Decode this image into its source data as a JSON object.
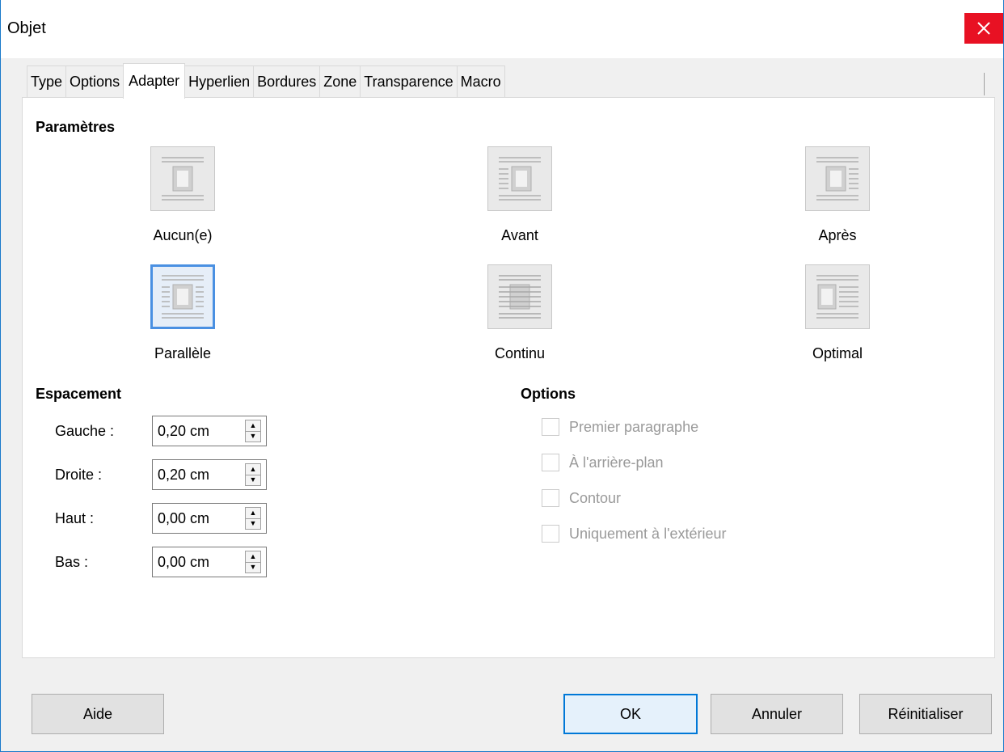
{
  "window": {
    "title": "Objet"
  },
  "tabs": [
    "Type",
    "Options",
    "Adapter",
    "Hyperlien",
    "Bordures",
    "Zone",
    "Transparence",
    "Macro"
  ],
  "active_tab": "Adapter",
  "parametres": {
    "title": "Paramètres",
    "items": [
      {
        "label": "Aucun(e)",
        "selected": false
      },
      {
        "label": "Avant",
        "selected": false
      },
      {
        "label": "Après",
        "selected": false
      },
      {
        "label": "Parallèle",
        "selected": true
      },
      {
        "label": "Continu",
        "selected": false
      },
      {
        "label": "Optimal",
        "selected": false
      }
    ]
  },
  "espacement": {
    "title": "Espacement",
    "rows": [
      {
        "label": "Gauche :",
        "value": "0,20 cm"
      },
      {
        "label": "Droite :",
        "value": "0,20 cm"
      },
      {
        "label": "Haut :",
        "value": "0,00 cm"
      },
      {
        "label": "Bas :",
        "value": "0,00 cm"
      }
    ]
  },
  "options": {
    "title": "Options",
    "items": [
      {
        "label": "Premier paragraphe",
        "checked": false,
        "enabled": false
      },
      {
        "label": "À l'arrière-plan",
        "checked": false,
        "enabled": false
      },
      {
        "label": "Contour",
        "checked": false,
        "enabled": false
      },
      {
        "label": "Uniquement à l'extérieur",
        "checked": false,
        "enabled": false
      }
    ]
  },
  "buttons": {
    "help": "Aide",
    "ok": "OK",
    "cancel": "Annuler",
    "reset": "Réinitialiser"
  },
  "colors": {
    "accent": "#0078d7",
    "close": "#e81123",
    "selection": "#4a90e2"
  }
}
